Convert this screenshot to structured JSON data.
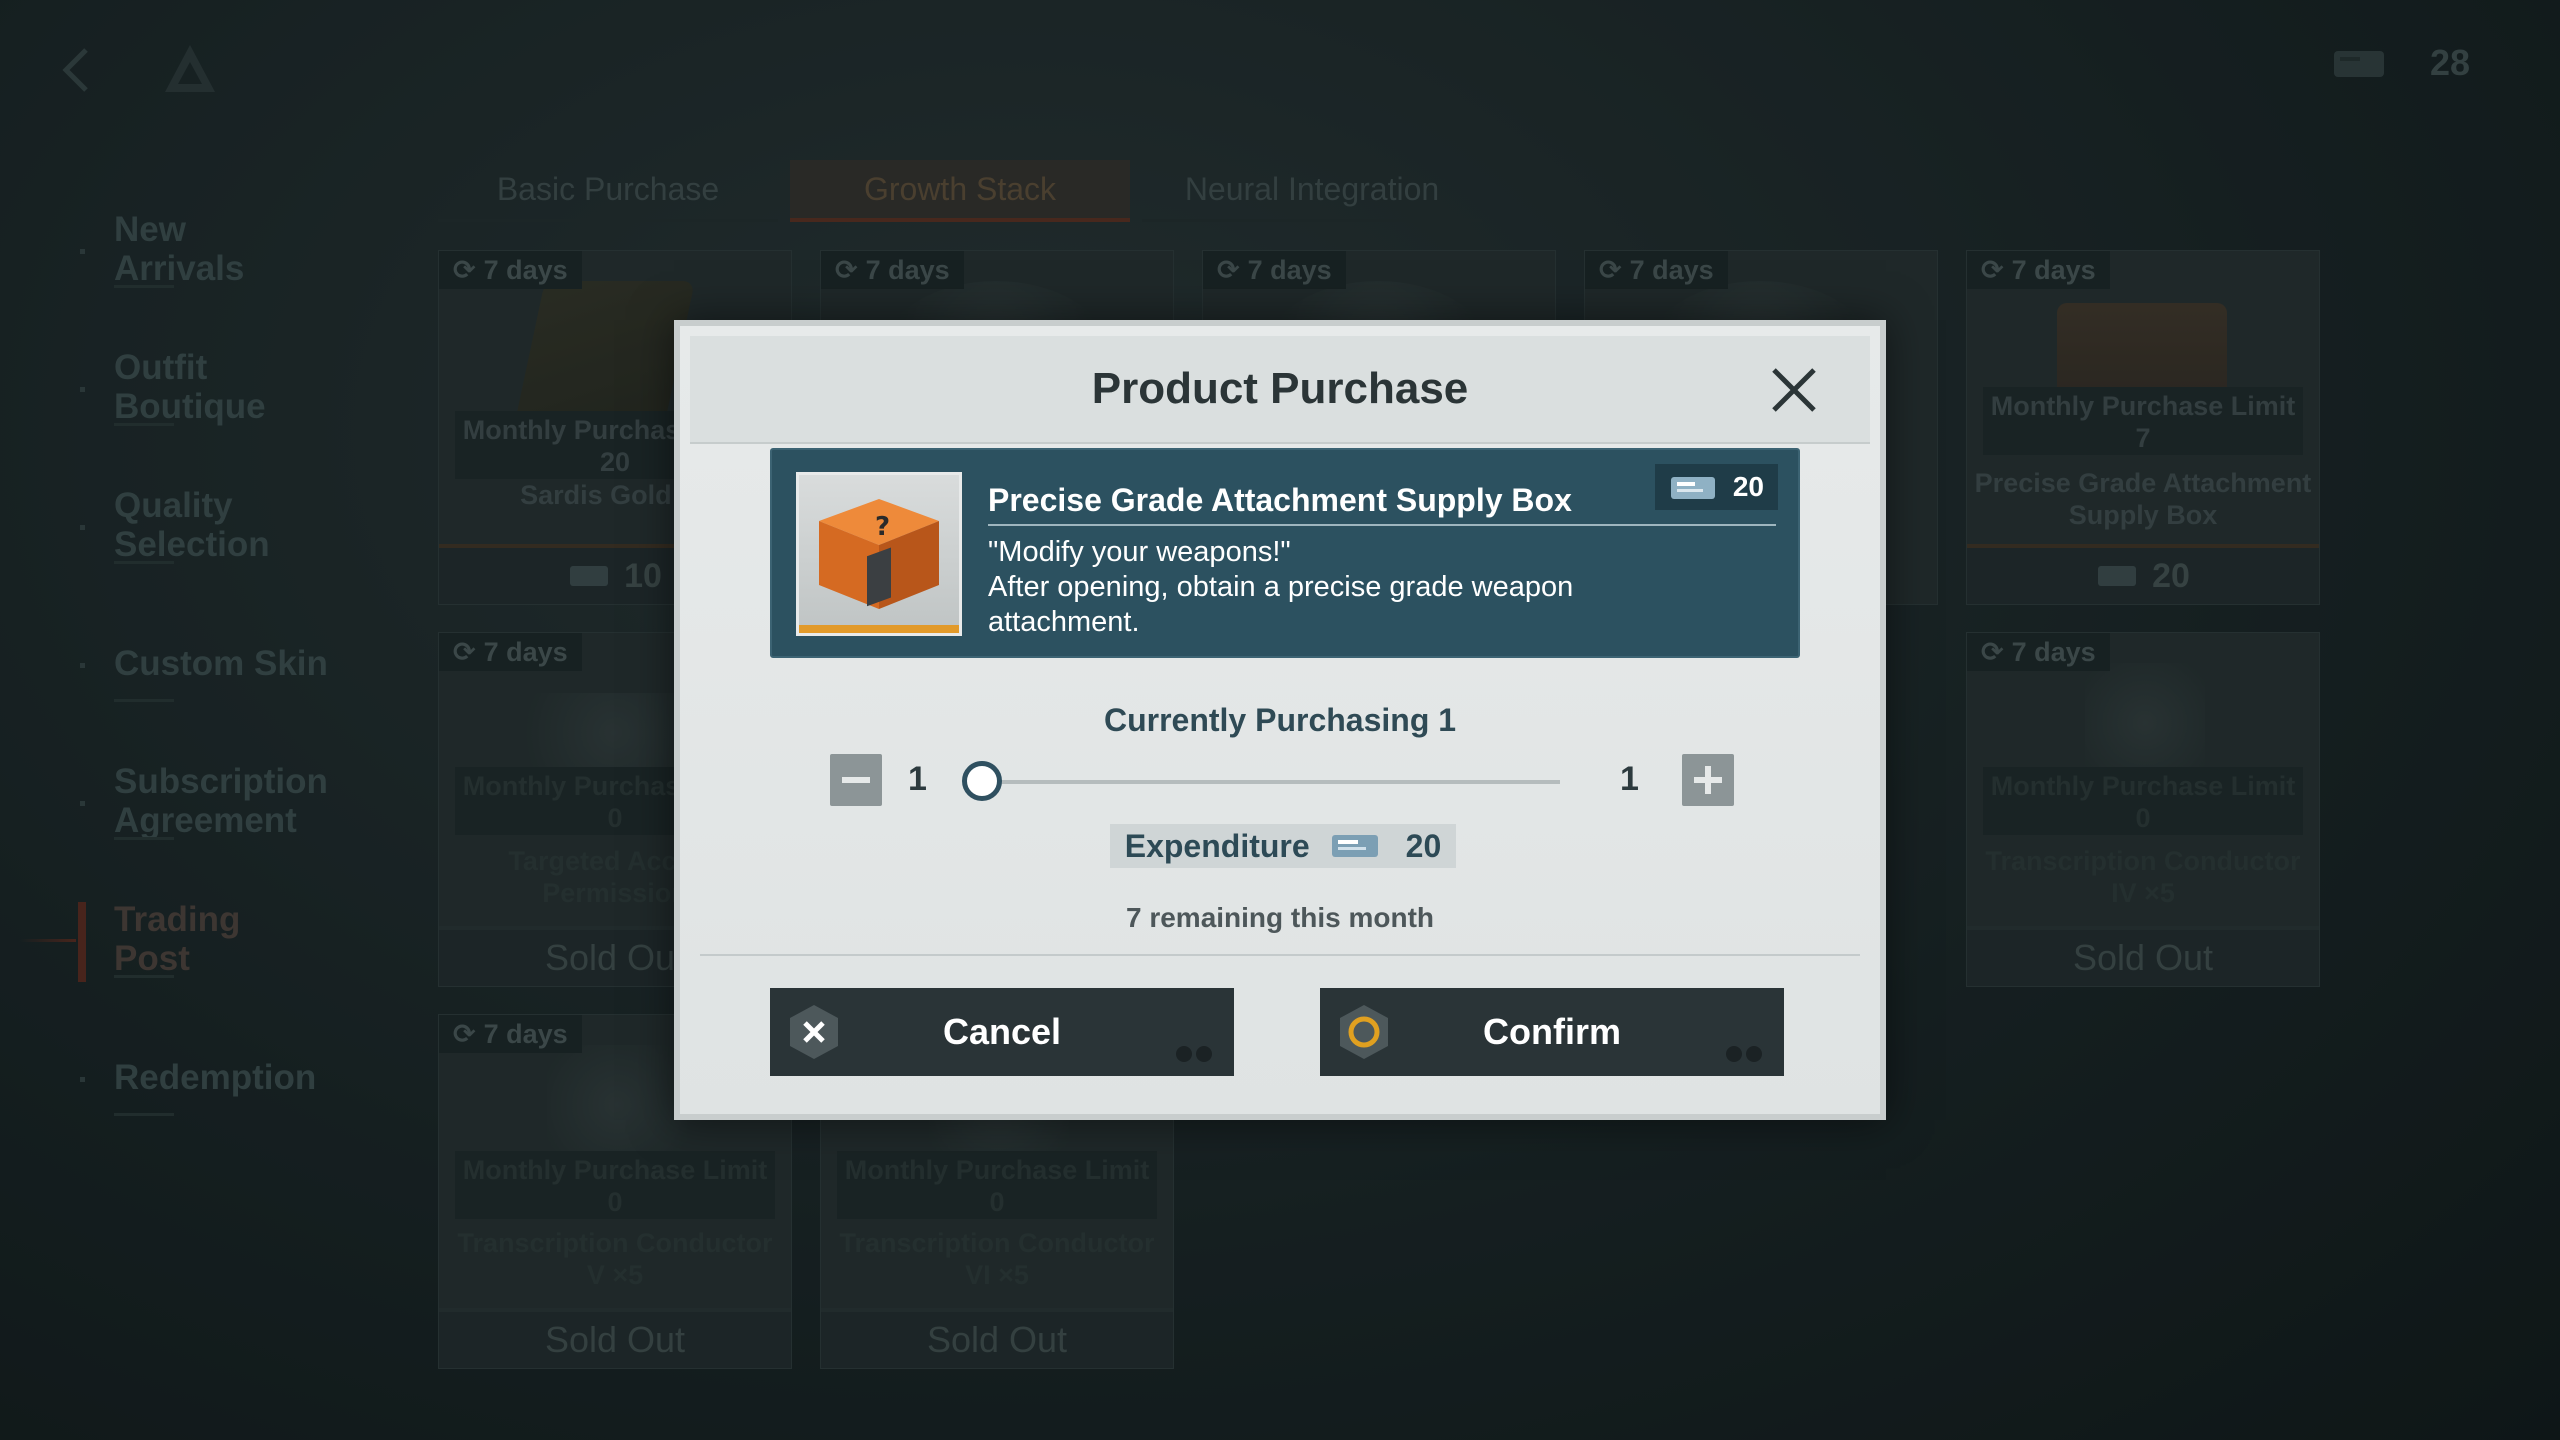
{
  "top_bar": {
    "currency_count": "28"
  },
  "sidebar": {
    "items": [
      {
        "label": "New Arrivals"
      },
      {
        "label": "Outfit Boutique"
      },
      {
        "label": "Quality Selection"
      },
      {
        "label": "Custom Skin"
      },
      {
        "label": "Subscription Agreement"
      },
      {
        "label": "Trading Post",
        "active": true
      },
      {
        "label": "Redemption"
      }
    ]
  },
  "tabs": [
    {
      "label": "Basic Purchase"
    },
    {
      "label": "Growth Stack",
      "active": true
    },
    {
      "label": "Neural Integration"
    }
  ],
  "cards": [
    {
      "timer": "7 days",
      "limit": "Monthly Purchase Limit 20",
      "name": "Sardis Gold ×5",
      "price": "10"
    },
    {
      "timer": "7 days"
    },
    {
      "timer": "7 days"
    },
    {
      "timer": "7 days"
    },
    {
      "timer": "7 days",
      "limit": "Monthly Purchase Limit 7",
      "name": "Precise Grade Attachment Supply Box",
      "price": "20"
    },
    {
      "timer": "7 days",
      "limit": "Monthly Purchase Limit 0",
      "name": "Targeted Access Permission",
      "status": "Sold Out"
    },
    {
      "timer": "7 days",
      "limit": "Monthly Purchase Limit 0",
      "name": "Transcription Conductor IV ×5",
      "status": "Sold Out"
    },
    {
      "timer": "7 days",
      "limit": "Monthly Purchase Limit 0",
      "name": "Transcription Conductor V ×5",
      "status": "Sold Out"
    },
    {
      "limit": "Monthly Purchase Limit 0",
      "name": "Transcription Conductor VI ×5",
      "status": "Sold Out"
    }
  ],
  "modal": {
    "title": "Product Purchase",
    "product": {
      "name": "Precise Grade Attachment Supply Box",
      "price": "20",
      "quote": "\"Modify your weapons!\"",
      "description": "After opening, obtain a precise grade weapon attachment."
    },
    "currently_purchasing": "Currently Purchasing 1",
    "quantity": {
      "min": "1",
      "max": "1",
      "current": 1
    },
    "expenditure_label": "Expenditure",
    "expenditure_value": "20",
    "remaining": "7 remaining this month",
    "cancel_label": "Cancel",
    "confirm_label": "Confirm"
  },
  "colors": {
    "accent": "#2c5160",
    "confirm_ring": "#e0a020",
    "active_tab": "#6a3524"
  },
  "icons": {
    "back": "chevron-left-icon",
    "logo": "triangle-logo-icon",
    "refresh": "refresh-icon",
    "ticket": "ticket-icon",
    "close": "close-icon",
    "cancel": "x-hex-icon",
    "confirm": "circle-hex-icon"
  }
}
